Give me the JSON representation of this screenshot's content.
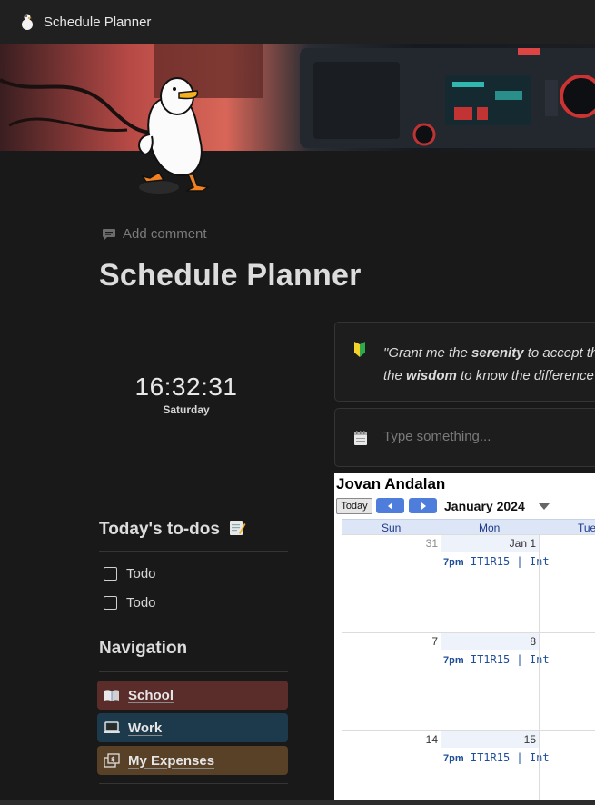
{
  "window": {
    "title": "Schedule Planner"
  },
  "page": {
    "add_comment": "Add comment",
    "title": "Schedule Planner"
  },
  "clock": {
    "time": "16:32:31",
    "day": "Saturday"
  },
  "quote": {
    "line1_a": "\"Grant me the ",
    "line1_b": "serenity",
    "line1_c": " to accept th",
    "line2_a": "the ",
    "line2_b": "wisdom",
    "line2_c": " to know the difference"
  },
  "input": {
    "placeholder": "Type something..."
  },
  "calendar": {
    "owner": "Jovan Andalan",
    "today_label": "Today",
    "month_label": "January 2024",
    "weekdays": [
      "Sun",
      "Mon",
      "Tue"
    ],
    "weeks": [
      {
        "days": [
          {
            "num": "31",
            "muted": true
          },
          {
            "num": "Jan 1",
            "event_time": "7pm",
            "event_title": "IT1R15 | Int"
          },
          {
            "num": ""
          }
        ]
      },
      {
        "days": [
          {
            "num": "7"
          },
          {
            "num": "8",
            "event_time": "7pm",
            "event_title": "IT1R15 | Int"
          },
          {
            "num": ""
          }
        ]
      },
      {
        "days": [
          {
            "num": "14"
          },
          {
            "num": "15",
            "event_time": "7pm",
            "event_title": "IT1R15 | Int"
          },
          {
            "num": ""
          }
        ]
      }
    ]
  },
  "todos": {
    "title": "Today's to-dos",
    "items": [
      {
        "label": "Todo",
        "checked": false
      },
      {
        "label": "Todo",
        "checked": false
      }
    ]
  },
  "navigation": {
    "title": "Navigation",
    "items": [
      {
        "label": "School",
        "icon": "book-icon",
        "color": "#5a2d2b"
      },
      {
        "label": "Work",
        "icon": "laptop-icon",
        "color": "#1c3a4c"
      },
      {
        "label": "My Expenses",
        "icon": "money-icon",
        "color": "#584126"
      }
    ]
  },
  "colors": {
    "background": "#191919",
    "topbar": "#202020",
    "calendar_accent": "#4e7ddc"
  }
}
